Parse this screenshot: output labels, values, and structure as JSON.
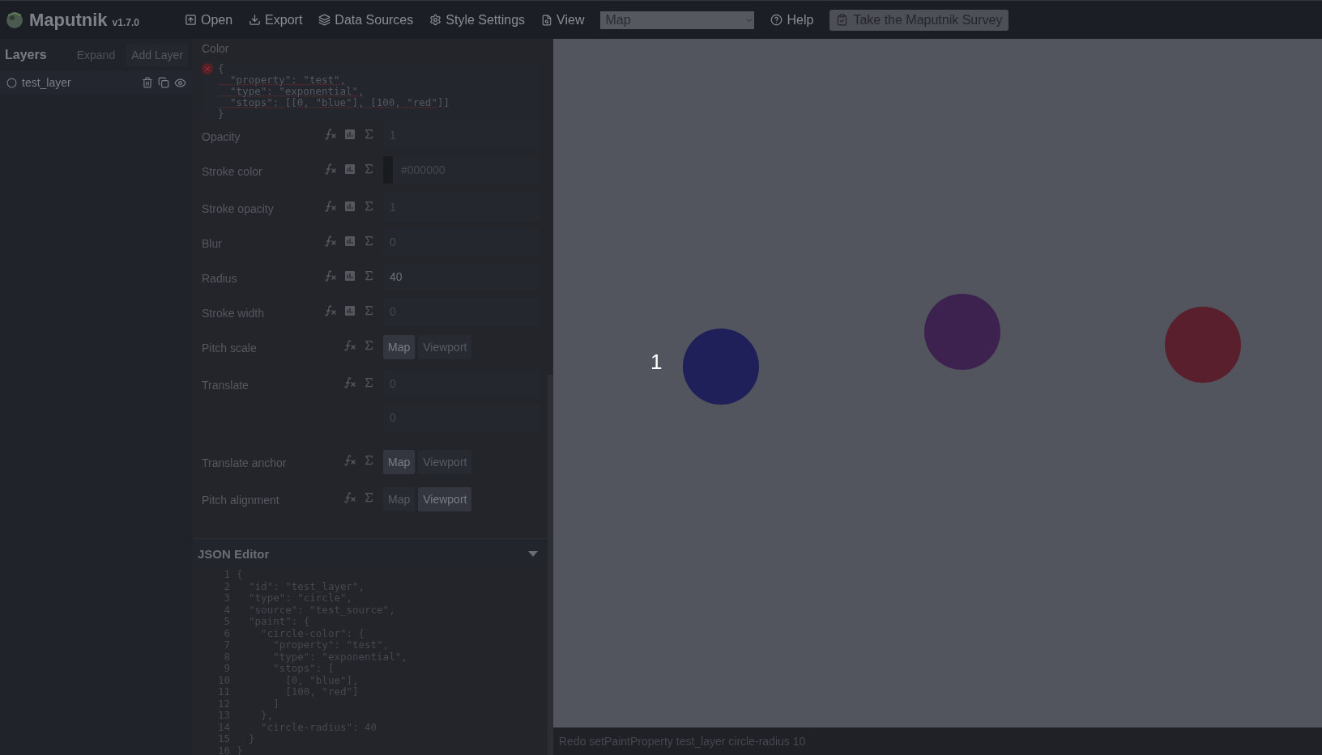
{
  "app": {
    "name": "Maputnik",
    "version": "v1.7.0"
  },
  "toolbar": {
    "items": [
      {
        "kind": "open",
        "label": "Open"
      },
      {
        "kind": "export",
        "label": "Export"
      },
      {
        "kind": "sources",
        "label": "Data Sources"
      },
      {
        "kind": "settings",
        "label": "Style Settings"
      }
    ],
    "view": {
      "label": "View",
      "value": "Map"
    },
    "help": "Help",
    "survey": "Take the Maputnik Survey"
  },
  "layers": {
    "title": "Layers",
    "expand": "Expand",
    "add": "Add Layer",
    "items": [
      {
        "name": "test_layer"
      }
    ]
  },
  "editor": {
    "color": {
      "label": "Color",
      "error": true,
      "lines": [
        "{",
        "  \"property\": \"test\",",
        "  \"type\": \"exponential\",",
        "  \"stops\": [[0, \"blue\"], [100, \"red\"]]",
        "}"
      ]
    },
    "properties": [
      {
        "kind": "value",
        "label": "Opacity",
        "values": [
          "1"
        ]
      },
      {
        "kind": "color",
        "label": "Stroke color",
        "values": [
          "#000000"
        ]
      },
      {
        "kind": "value",
        "label": "Stroke opacity",
        "values": [
          "1"
        ]
      },
      {
        "kind": "value",
        "label": "Blur",
        "values": [
          "0"
        ]
      },
      {
        "kind": "value",
        "label": "Radius",
        "values": [
          "40"
        ]
      },
      {
        "kind": "value",
        "label": "Stroke width",
        "values": [
          "0"
        ]
      },
      {
        "kind": "enum",
        "label": "Pitch scale",
        "options": [
          {
            "label": "Map",
            "selected": true
          },
          {
            "label": "Viewport",
            "selected": false
          }
        ]
      },
      {
        "kind": "pair",
        "label": "Translate",
        "values": [
          "0",
          "0"
        ]
      },
      {
        "kind": "enum",
        "label": "Translate anchor",
        "options": [
          {
            "label": "Map",
            "selected": true
          },
          {
            "label": "Viewport",
            "selected": false
          }
        ]
      },
      {
        "kind": "enum",
        "label": "Pitch alignment",
        "options": [
          {
            "label": "Map",
            "selected": false
          },
          {
            "label": "Viewport",
            "selected": true
          }
        ]
      }
    ],
    "json_editor": {
      "title": "JSON Editor",
      "expanded": true,
      "lines": [
        {
          "number": "1",
          "text": "{"
        },
        {
          "number": "2",
          "text": "  \"id\": \"test_layer\","
        },
        {
          "number": "3",
          "text": "  \"type\": \"circle\","
        },
        {
          "number": "4",
          "text": "  \"source\": \"test_source\","
        },
        {
          "number": "5",
          "text": "  \"paint\": {"
        },
        {
          "number": "6",
          "text": "    \"circle-color\": {"
        },
        {
          "number": "7",
          "text": "      \"property\": \"test\","
        },
        {
          "number": "8",
          "text": "      \"type\": \"exponential\","
        },
        {
          "number": "9",
          "text": "      \"stops\": ["
        },
        {
          "number": "10",
          "text": "        [0, \"blue\"],"
        },
        {
          "number": "11",
          "text": "        [100, \"red\"]"
        },
        {
          "number": "12",
          "text": "      ]"
        },
        {
          "number": "13",
          "text": "    },"
        },
        {
          "number": "14",
          "text": "    \"circle-radius\": 40"
        },
        {
          "number": "15",
          "text": "  }"
        },
        {
          "number": "16",
          "text": "}"
        }
      ]
    }
  },
  "map": {
    "features": [
      {
        "label": "1",
        "color": "#1f1f5a"
      },
      {
        "color": "#3d2250"
      },
      {
        "color": "#5a1f2c"
      }
    ]
  },
  "status_bar": "Redo setPaintProperty test_layer circle-radius 10"
}
